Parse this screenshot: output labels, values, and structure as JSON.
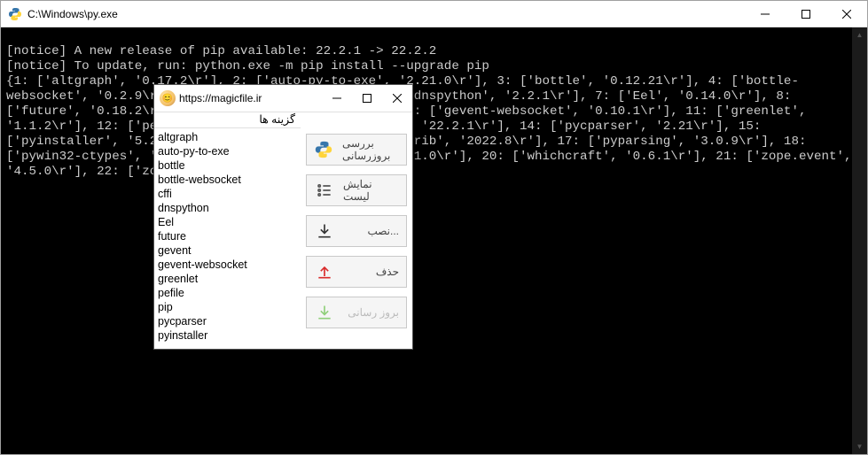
{
  "outer": {
    "title": "C:\\Windows\\py.exe",
    "terminal_text": "\n[notice] A new release of pip available: 22.2.1 -> 22.2.2\n[notice] To update, run: python.exe -m pip install --upgrade pip\n{1: ['altgraph', '0.17.2\\r'], 2: ['auto-py-to-exe', '2.21.0\\r'], 3: ['bottle', '0.12.21\\r'], 4: ['bottle-websocket', '0.2.9\\r'], 5: ['cffi', '1.15.1\\r'], 6: ['dnspython', '2.2.1\\r'], 7: ['Eel', '0.14.0\\r'], 8: ['future', '0.18.2\\r'], 9: ['gevent', '21.12.0\\r'], 10: ['gevent-websocket', '0.10.1\\r'], 11: ['greenlet', '1.1.2\\r'], 12: ['pefile', '2022.5.30\\r'], 13: ['pip', '22.2.1\\r'], 14: ['pycparser', '2.21\\r'], 15: ['pyinstaller', '5.2\\r'], 16: ['pyinstaller-hooks-contrib', '2022.8\\r'], 17: ['pyparsing', '3.0.9\\r'], 18: ['pywin32-ctypes', '0.2.0\\r'], 19: ['setuptools', '58.1.0\\r'], 20: ['whichcraft', '0.6.1\\r'], 21: ['zope.event', '4.5.0\\r'], 22: ['zope.interface', '5.4.0\\r']}"
  },
  "dialog": {
    "url": "https://magicfile.ir",
    "options_label": "گزینه ها",
    "packages": [
      "altgraph",
      "auto-py-to-exe",
      "bottle",
      "bottle-websocket",
      "cffi",
      "dnspython",
      "Eel",
      "future",
      "gevent",
      "gevent-websocket",
      "greenlet",
      "pefile",
      "pip",
      "pycparser",
      "pyinstaller"
    ],
    "buttons": {
      "refresh": "بررسی بروزرسانی",
      "showlist": "نمایش لیست",
      "install": "نصب...",
      "remove": "حذف",
      "update": "بروز رسانی"
    }
  }
}
